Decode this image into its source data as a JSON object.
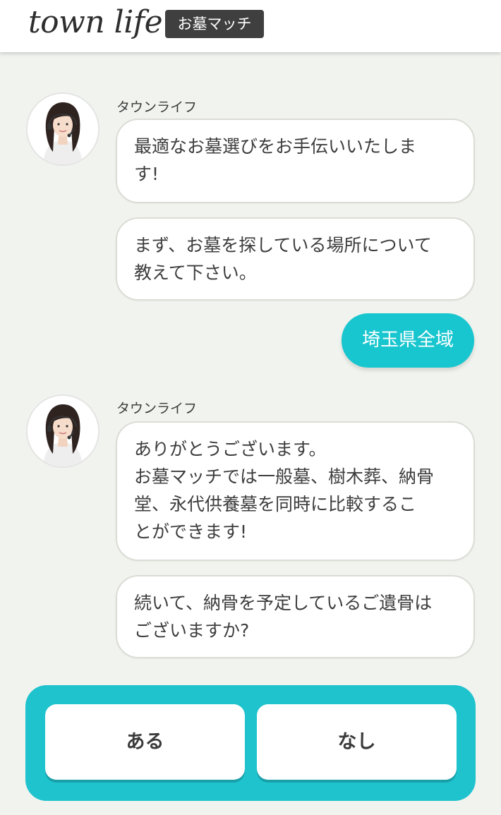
{
  "header": {
    "logo_text": "town life",
    "badge_text": "お墓マッチ"
  },
  "chat": {
    "messages": [
      {
        "sender": "タウンライフ",
        "bubbles": [
          "最適なお墓選びをお手伝いいたしま\nす!",
          "まず、お墓を探している場所について\n教えて下さい。"
        ]
      },
      {
        "user_reply": "埼玉県全域"
      },
      {
        "sender": "タウンライフ",
        "bubbles": [
          "ありがとうございます。\nお墓マッチでは一般墓、樹木葬、納骨\n堂、永代供養墓を同時に比較するこ\nとができます!",
          "続いて、納骨を予定しているご遺骨は\nございますか?"
        ]
      }
    ]
  },
  "answers": {
    "options": [
      "ある",
      "なし"
    ]
  },
  "colors": {
    "accent": "#1ec3ce",
    "user_bubble": "#18c6cf",
    "background": "#f1f3ee"
  },
  "icons": {
    "avatar": "operator-avatar"
  }
}
